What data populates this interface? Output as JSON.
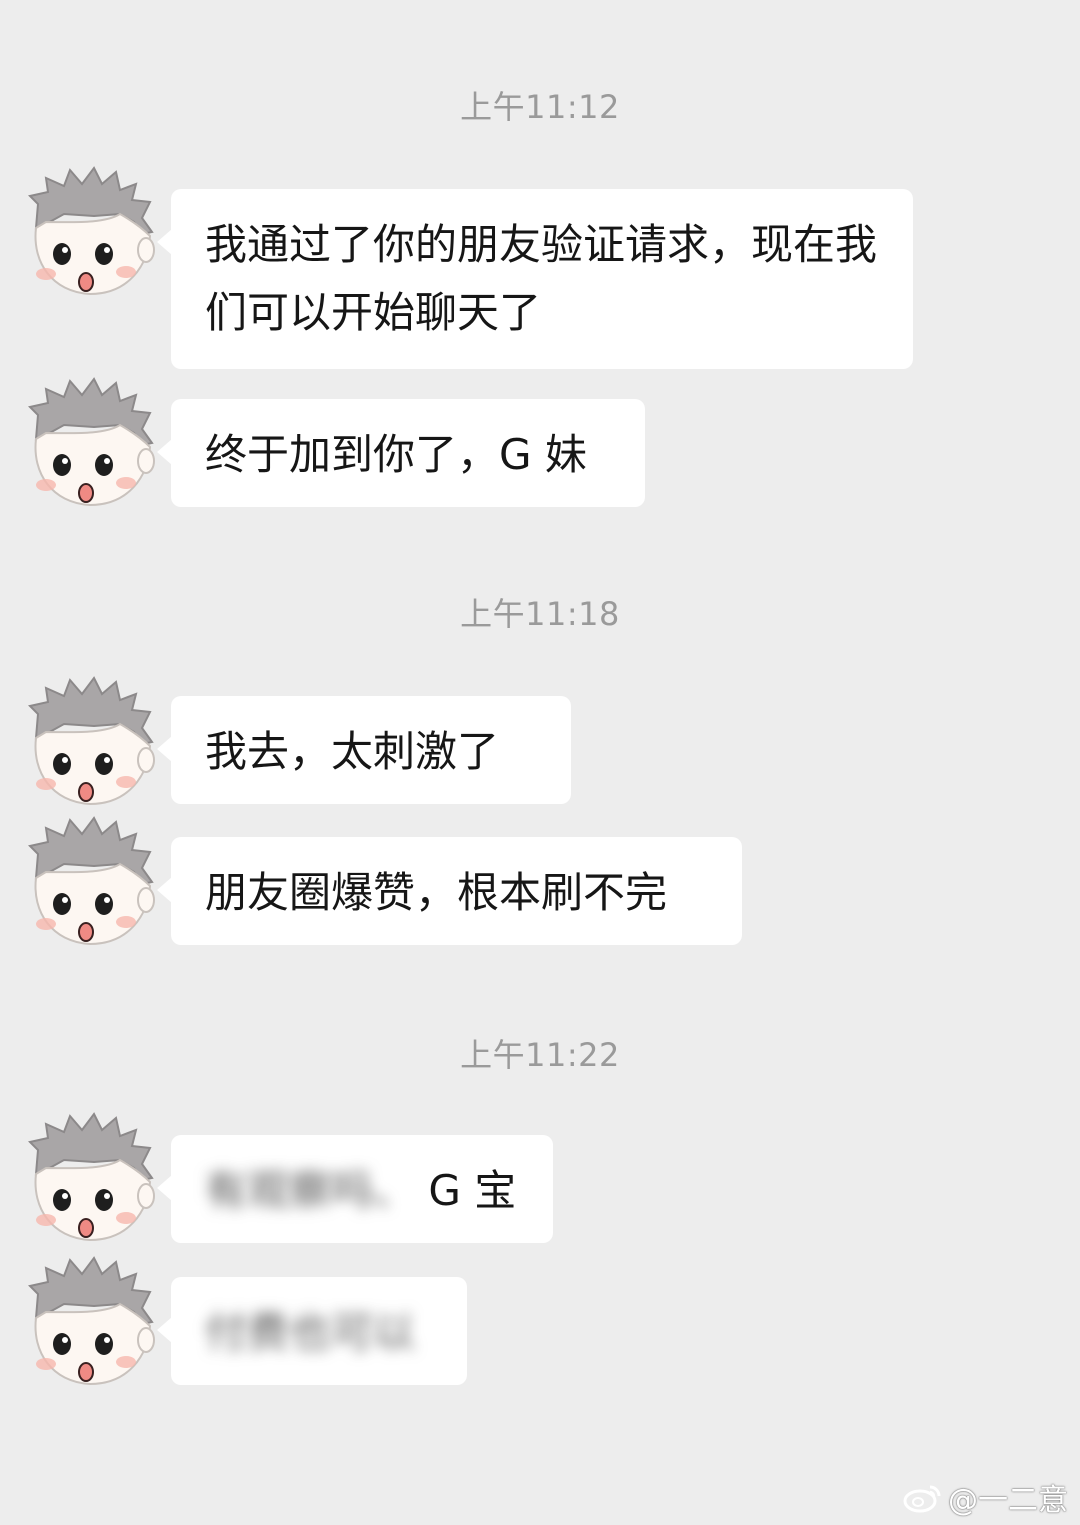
{
  "chat": {
    "timestamps": [
      "上午11:12",
      "上午11:18",
      "上午11:22"
    ],
    "messages": [
      {
        "text": "我通过了你的朋友验证请求，现在我们可以开始聊天了"
      },
      {
        "text": "终于加到你了，G 妹"
      },
      {
        "text": "我去，太刺激了"
      },
      {
        "text": "朋友圈爆赞，根本刷不完"
      },
      {
        "text_blurred": "有观察吗、",
        "text": "G 宝"
      },
      {
        "text_blurred": "付费也可以"
      }
    ]
  },
  "watermark": {
    "text": "@一二意",
    "icon": "weibo-icon"
  },
  "colors": {
    "background": "#ededed",
    "bubble": "#ffffff",
    "timestamp": "#9a9a9a"
  }
}
